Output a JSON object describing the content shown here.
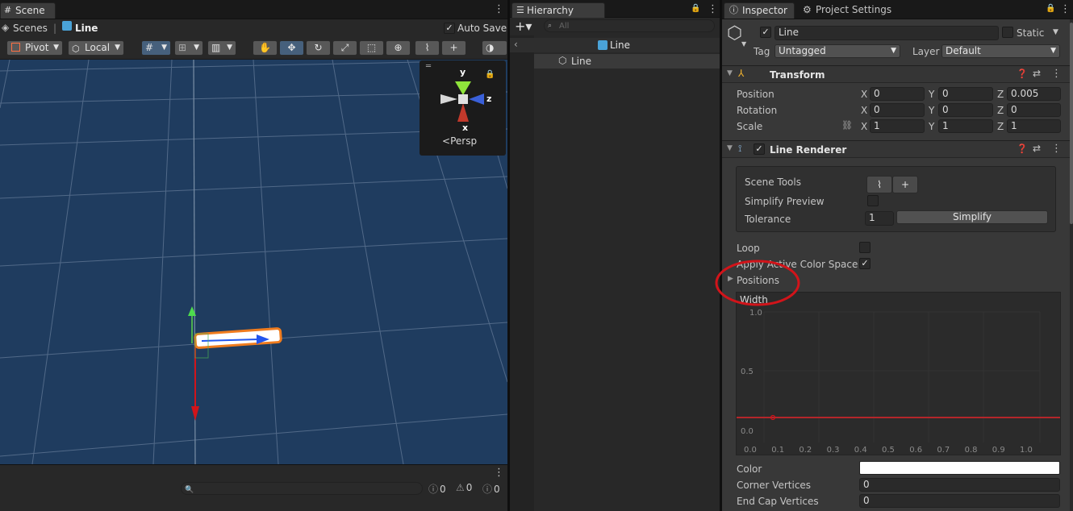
{
  "scene": {
    "tab": "Scene",
    "scenes_label": "Scenes",
    "line_label": "Line",
    "auto_save_label": "Auto Save",
    "pivot_label": "Pivot",
    "local_label": "Local",
    "persp_label": "Persp",
    "axis_y": "y",
    "axis_z": "z",
    "axis_x": "x",
    "console_counts": [
      "0",
      "0",
      "0"
    ]
  },
  "hierarchy": {
    "tab": "Hierarchy",
    "search_placeholder": "All",
    "scene_name": "Line",
    "items": [
      {
        "label": "Line"
      }
    ]
  },
  "inspector": {
    "tab": "Inspector",
    "tab2": "Project Settings",
    "object_name": "Line",
    "static_label": "Static",
    "tag_label": "Tag",
    "tag_value": "Untagged",
    "layer_label": "Layer",
    "layer_value": "Default"
  },
  "transform": {
    "title": "Transform",
    "rows": [
      {
        "label": "Position",
        "x": "0",
        "y": "0",
        "z": "0.005"
      },
      {
        "label": "Rotation",
        "x": "0",
        "y": "0",
        "z": "0"
      },
      {
        "label": "Scale",
        "x": "1",
        "y": "1",
        "z": "1"
      }
    ],
    "axes": [
      "X",
      "Y",
      "Z"
    ]
  },
  "line_renderer": {
    "title": "Line Renderer",
    "scene_tools_label": "Scene Tools",
    "simplify_preview_label": "Simplify Preview",
    "tolerance_label": "Tolerance",
    "tolerance_value": "1",
    "simplify_button": "Simplify",
    "loop_label": "Loop",
    "apply_color_label": "Apply Active Color Space",
    "positions_label": "Positions",
    "width_label": "Width",
    "curve_y_labels": [
      "1.0",
      "0.5",
      "0.0"
    ],
    "curve_x_labels": [
      "0.0",
      "0.1",
      "0.2",
      "0.3",
      "0.4",
      "0.5",
      "0.6",
      "0.7",
      "0.8",
      "0.9",
      "1.0"
    ],
    "color_label": "Color",
    "color_value": "#ffffff",
    "corner_vertices_label": "Corner Vertices",
    "corner_vertices_value": "0",
    "end_cap_label": "End Cap Vertices",
    "end_cap_value": "0"
  },
  "colors": {
    "scene_bg": "#1f3c5f",
    "grid": "#5a7290",
    "accent_red": "#d1141a",
    "selection": "#f07c1e"
  }
}
